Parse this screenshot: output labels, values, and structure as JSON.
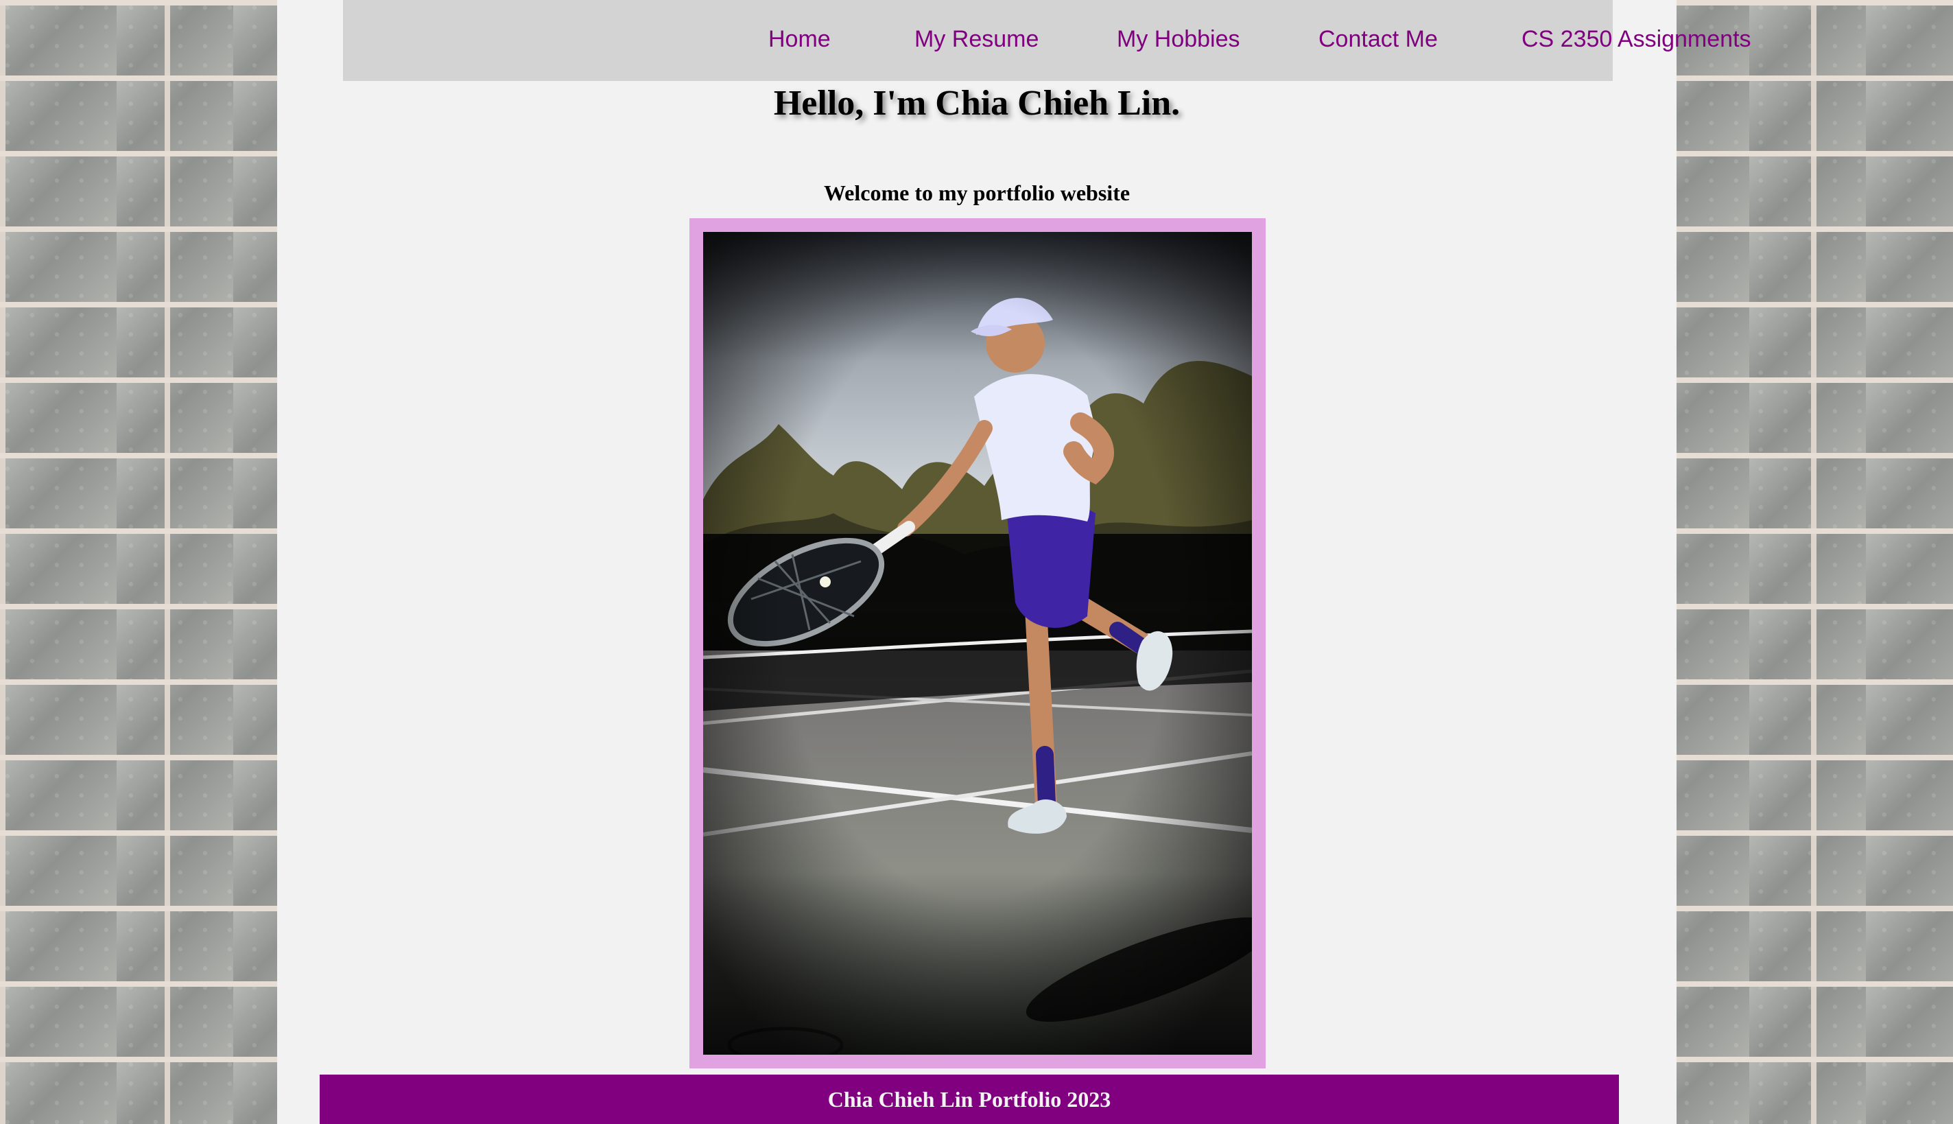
{
  "nav": {
    "items": [
      {
        "label": "Home"
      },
      {
        "label": "My Resume"
      },
      {
        "label": "My Hobbies"
      },
      {
        "label": "Contact Me"
      },
      {
        "label": "CS 2350 Assignments"
      }
    ],
    "link_color": "#800080",
    "background": "#d3d3d3"
  },
  "hero": {
    "heading": "Hello, I'm Chia Chieh Lin.",
    "subheading": "Welcome to my portfolio website"
  },
  "photo": {
    "frame_color": "#e0a2e0"
  },
  "footer": {
    "text": "Chia Chieh Lin Portfolio 2023",
    "background": "#800080"
  },
  "colors": {
    "page_background": "#f2f2f2",
    "brick_wall": "#a7a9a6"
  }
}
